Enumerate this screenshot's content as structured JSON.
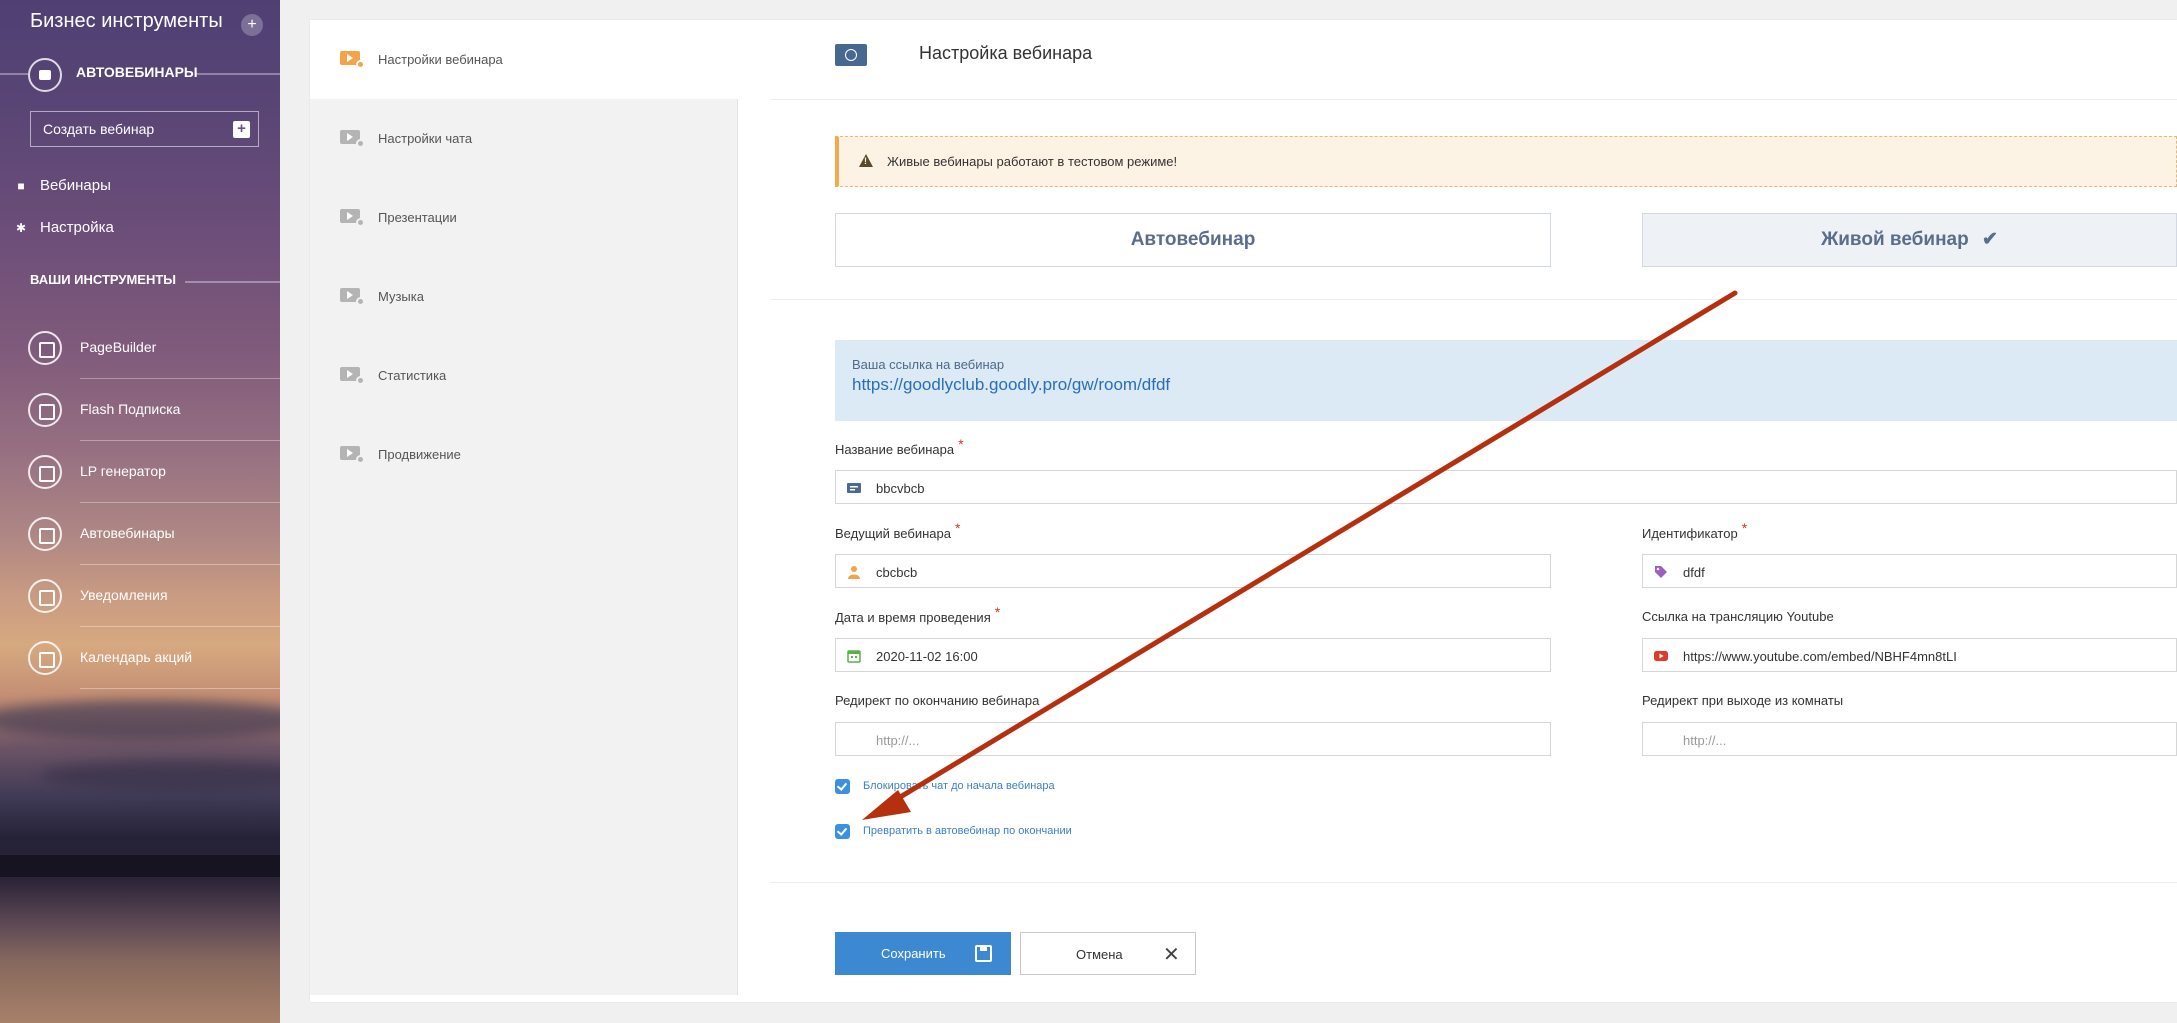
{
  "sidebar": {
    "title": "Бизнес инструменты",
    "section": "АВТОВЕБИНАРЫ",
    "create_button": "Создать вебинар",
    "links": [
      {
        "label": "Вебинары",
        "icon": "video-camera-icon"
      },
      {
        "label": "Настройка",
        "icon": "gear-icon"
      }
    ],
    "your_tools": "ВАШИ ИНСТРУМЕНТЫ",
    "tools": [
      {
        "label": "PageBuilder"
      },
      {
        "label": "Flash Подписка"
      },
      {
        "label": "LP генератор"
      },
      {
        "label": "Автовебинары"
      },
      {
        "label": "Уведомления"
      },
      {
        "label": "Календарь акций"
      }
    ]
  },
  "subnav": {
    "items": [
      {
        "label": "Настройки вебинара",
        "active": true
      },
      {
        "label": "Настройки чата"
      },
      {
        "label": "Презентации"
      },
      {
        "label": "Музыка"
      },
      {
        "label": "Статистика"
      },
      {
        "label": "Продвижение"
      }
    ]
  },
  "main": {
    "title": "Настройка вебинара",
    "warning": "Живые вебинары работают в тестовом режиме!",
    "mode": {
      "auto": "Автовебинар",
      "live": "Живой вебинар",
      "live_check": "✔"
    },
    "link": {
      "label": "Ваша ссылка на вебинар",
      "url": "https://goodlyclub.goodly.pro/gw/room/dfdf"
    },
    "fields": {
      "name": {
        "label": "Название вебинара",
        "value": "bbcvbcb"
      },
      "host": {
        "label": "Ведущий вебинара",
        "value": "cbcbcb"
      },
      "identifier": {
        "label": "Идентификатор",
        "value": "dfdf"
      },
      "datetime": {
        "label": "Дата и время проведения",
        "value": "2020-11-02 16:00"
      },
      "youtube": {
        "label": "Ссылка на трансляцию Youtube",
        "value": "https://www.youtube.com/embed/NBHF4mn8tLI"
      },
      "redirect_end": {
        "label": "Редирект по окончанию вебинара",
        "placeholder": "http://..."
      },
      "redirect_exit": {
        "label": "Редирект при выходе из комнаты",
        "placeholder": "http://..."
      }
    },
    "required_mark": "*",
    "checkboxes": [
      {
        "label": "Блокировать чат до начала вебинара",
        "checked": true
      },
      {
        "label": "Превратить в автовебинар по окончании",
        "checked": true
      }
    ],
    "save": "Сохранить",
    "cancel": "Отмена"
  },
  "colors": {
    "accent": "#3c88d1",
    "arrow": "#b5300f",
    "warning_border": "#f0ab50"
  }
}
